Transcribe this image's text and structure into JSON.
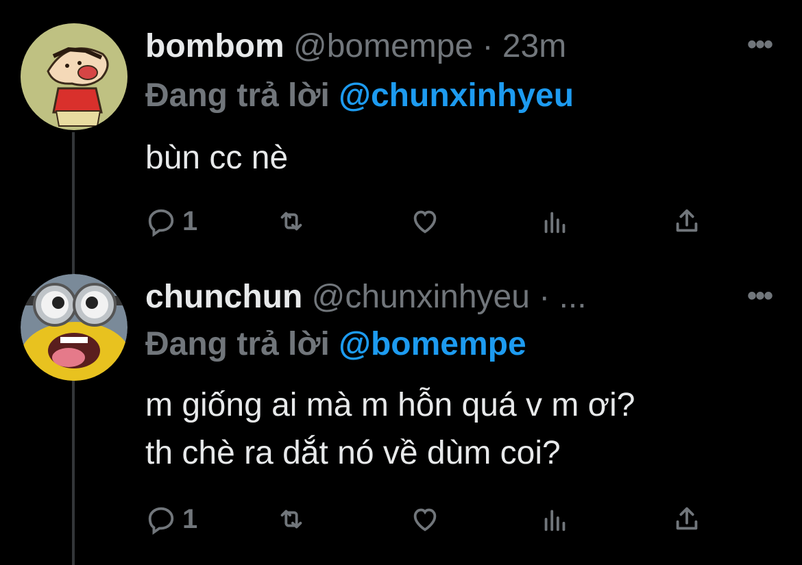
{
  "tweets": [
    {
      "display_name": "bombom",
      "handle": "@bomempe",
      "separator": "·",
      "time": "23m",
      "more_label": "•••",
      "reply_label": "Đang trả lời",
      "reply_to": "@chunxinhyeu",
      "body_lines": [
        "bùn cc nè"
      ],
      "reply_count": "1",
      "avatar_icon": "shin-chan-avatar"
    },
    {
      "display_name": "chunchun",
      "handle": "@chunxinhyeu",
      "separator": "·",
      "time": "...",
      "more_label": "•••",
      "reply_label": "Đang trả lời",
      "reply_to": "@bomempe",
      "body_lines": [
        "m giống ai mà m hỗn quá v m ơi?",
        "th chè ra dắt nó về dùm coi?"
      ],
      "reply_count": "1",
      "avatar_icon": "minion-avatar"
    }
  ],
  "colors": {
    "background": "#000000",
    "text": "#e7e9ea",
    "muted": "#71767b",
    "mention": "#1d9bf0",
    "thread_line": "#333639"
  }
}
